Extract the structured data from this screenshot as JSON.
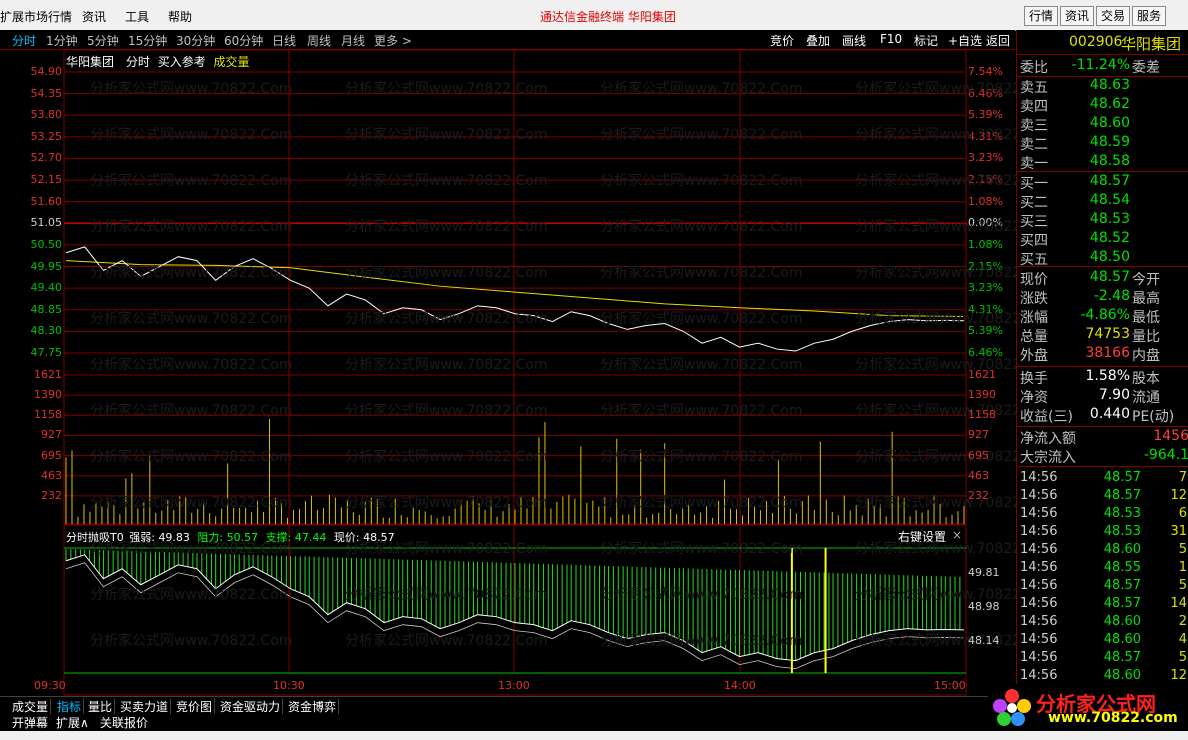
{
  "menu": {
    "items": [
      "扩展市场行情",
      "资讯",
      "工具",
      "帮助"
    ],
    "center_title": "通达信金融终端   华阳集团",
    "right_buttons": [
      "行情",
      "资讯",
      "交易",
      "服务"
    ]
  },
  "toolbar": {
    "periods": [
      "分时",
      "1分钟",
      "5分钟",
      "15分钟",
      "30分钟",
      "60分钟",
      "日线",
      "周线",
      "月线",
      "更多 >"
    ],
    "right": [
      "竞价",
      "叠加",
      "画线",
      "F10",
      "标记",
      "+自选",
      "返回"
    ]
  },
  "chart_header": {
    "name": "华阳集团",
    "mode": "分时",
    "ref": "买入参考",
    "vol": "成交量"
  },
  "watermark": "分析家公式网www.70822.Com",
  "indicator_header": {
    "name": "分时抛吸T0",
    "strength_label": "强弱:",
    "strength_value": "49.83",
    "resist_label": "阻力:",
    "resist_value": "50.57",
    "support_label": "支撑:",
    "support_value": "47.44",
    "price_label": "现价:",
    "price_value": "48.57",
    "settings": "右键设置",
    "close": "×"
  },
  "chart_data": {
    "type": "line",
    "title": "华阳集团 分时",
    "price_axis": {
      "left_ticks": [
        "54.90",
        "54.35",
        "53.80",
        "53.25",
        "52.70",
        "52.15",
        "51.60",
        "51.05",
        "50.50",
        "49.95",
        "49.40",
        "48.85",
        "48.30",
        "47.75"
      ],
      "right_ticks": [
        "7.54%",
        "6.46%",
        "5.39%",
        "4.31%",
        "3.23%",
        "2.15%",
        "1.08%",
        "0.00%",
        "1.08%",
        "2.15%",
        "3.23%",
        "4.31%",
        "5.39%",
        "6.46%"
      ],
      "ylim": [
        47.75,
        54.9
      ],
      "prev_close": 51.05
    },
    "x_ticks": [
      "09:30",
      "10:30",
      "13:00",
      "14:00",
      "15:00"
    ],
    "series": [
      {
        "name": "价格",
        "color": "#ffffff",
        "x": [
          0,
          5,
          10,
          15,
          20,
          25,
          30,
          35,
          40,
          45,
          50,
          55,
          60,
          65,
          70,
          75,
          80,
          85,
          90,
          95,
          100,
          105,
          110,
          115,
          120,
          125,
          130,
          135,
          140,
          145,
          150,
          155,
          160,
          165,
          170,
          175,
          180,
          185,
          190,
          195,
          200,
          205,
          210,
          215,
          220,
          225,
          230,
          235,
          240
        ],
        "values": [
          50.3,
          50.45,
          49.85,
          50.1,
          49.7,
          49.95,
          50.2,
          50.1,
          49.6,
          49.95,
          50.15,
          49.9,
          49.6,
          49.4,
          48.95,
          49.25,
          49.1,
          48.75,
          48.9,
          48.85,
          48.6,
          48.75,
          48.95,
          48.9,
          48.75,
          48.7,
          48.55,
          48.8,
          48.7,
          48.5,
          48.35,
          48.45,
          48.5,
          48.3,
          48.0,
          48.15,
          47.9,
          48.0,
          47.85,
          47.8,
          48.0,
          48.1,
          48.3,
          48.45,
          48.55,
          48.6,
          48.57,
          48.58,
          48.57
        ]
      },
      {
        "name": "均价",
        "color": "#e0e000",
        "x": [
          0,
          20,
          40,
          60,
          80,
          100,
          120,
          140,
          160,
          180,
          200,
          220,
          240
        ],
        "values": [
          50.1,
          50.0,
          49.98,
          49.92,
          49.68,
          49.45,
          49.3,
          49.15,
          49.0,
          48.9,
          48.82,
          48.7,
          48.68
        ]
      }
    ],
    "volume": {
      "ticks": [
        "1621",
        "1390",
        "1158",
        "927",
        "695",
        "463",
        "232"
      ],
      "ylim": [
        0,
        1621
      ],
      "color": "#e0c000"
    },
    "indicator": {
      "ticks": [
        "49.81",
        "48.98",
        "48.14"
      ],
      "resist": 50.57,
      "support": 47.44
    }
  },
  "right_panel": {
    "code": "002906",
    "name": "华阳集团",
    "weibi_label": "委比",
    "weibi_value": "-11.24%",
    "weicha_label": "委差",
    "asks": [
      {
        "label": "卖五",
        "price": "48.63"
      },
      {
        "label": "卖四",
        "price": "48.62"
      },
      {
        "label": "卖三",
        "price": "48.60"
      },
      {
        "label": "卖二",
        "price": "48.59"
      },
      {
        "label": "卖一",
        "price": "48.58"
      }
    ],
    "bids": [
      {
        "label": "买一",
        "price": "48.57"
      },
      {
        "label": "买二",
        "price": "48.54"
      },
      {
        "label": "买三",
        "price": "48.53"
      },
      {
        "label": "买四",
        "price": "48.52"
      },
      {
        "label": "买五",
        "price": "48.50"
      }
    ],
    "stats": [
      {
        "label": "现价",
        "value": "48.57",
        "label2": "今开",
        "color": "#00e000"
      },
      {
        "label": "涨跌",
        "value": "-2.48",
        "label2": "最高",
        "color": "#00e000"
      },
      {
        "label": "涨幅",
        "value": "-4.86%",
        "label2": "最低",
        "color": "#00e000"
      },
      {
        "label": "总量",
        "value": "74753",
        "label2": "量比",
        "color": "#e0e000"
      },
      {
        "label": "外盘",
        "value": "38166",
        "label2": "内盘",
        "color": "#ff4040"
      }
    ],
    "stats2": [
      {
        "label": "换手",
        "value": "1.58%",
        "label2": "股本",
        "color": "#ffffff"
      },
      {
        "label": "净资",
        "value": "7.90",
        "label2": "流通",
        "color": "#ffffff"
      },
      {
        "label": "收益(三)",
        "value": "0.440",
        "label2": "PE(动)",
        "color": "#ffffff"
      }
    ],
    "flows": [
      {
        "label": "净流入额",
        "value": "1456",
        "color": "#ff4040"
      },
      {
        "label": "大宗流入",
        "value": "-964.1",
        "color": "#00e000"
      }
    ],
    "ticks": [
      {
        "t": "14:56",
        "p": "48.57",
        "v": "7"
      },
      {
        "t": "14:56",
        "p": "48.57",
        "v": "12"
      },
      {
        "t": "14:56",
        "p": "48.53",
        "v": "6"
      },
      {
        "t": "14:56",
        "p": "48.53",
        "v": "31"
      },
      {
        "t": "14:56",
        "p": "48.60",
        "v": "5"
      },
      {
        "t": "14:56",
        "p": "48.55",
        "v": "1"
      },
      {
        "t": "14:56",
        "p": "48.57",
        "v": "5"
      },
      {
        "t": "14:56",
        "p": "48.57",
        "v": "14"
      },
      {
        "t": "14:56",
        "p": "48.60",
        "v": "2"
      },
      {
        "t": "14:56",
        "p": "48.60",
        "v": "4"
      },
      {
        "t": "14:56",
        "p": "48.57",
        "v": "5"
      },
      {
        "t": "14:56",
        "p": "48.60",
        "v": "12"
      }
    ]
  },
  "bottom_tabs": [
    "成交量",
    "指标",
    "量比",
    "买卖力道",
    "竞价图",
    "资金驱动力",
    "资金博弈"
  ],
  "bottom_tabs2": [
    "开弹幕",
    "扩展∧",
    "关联报价"
  ],
  "logo": {
    "text": "分析家公式网",
    "sub": "www.70822.com"
  }
}
